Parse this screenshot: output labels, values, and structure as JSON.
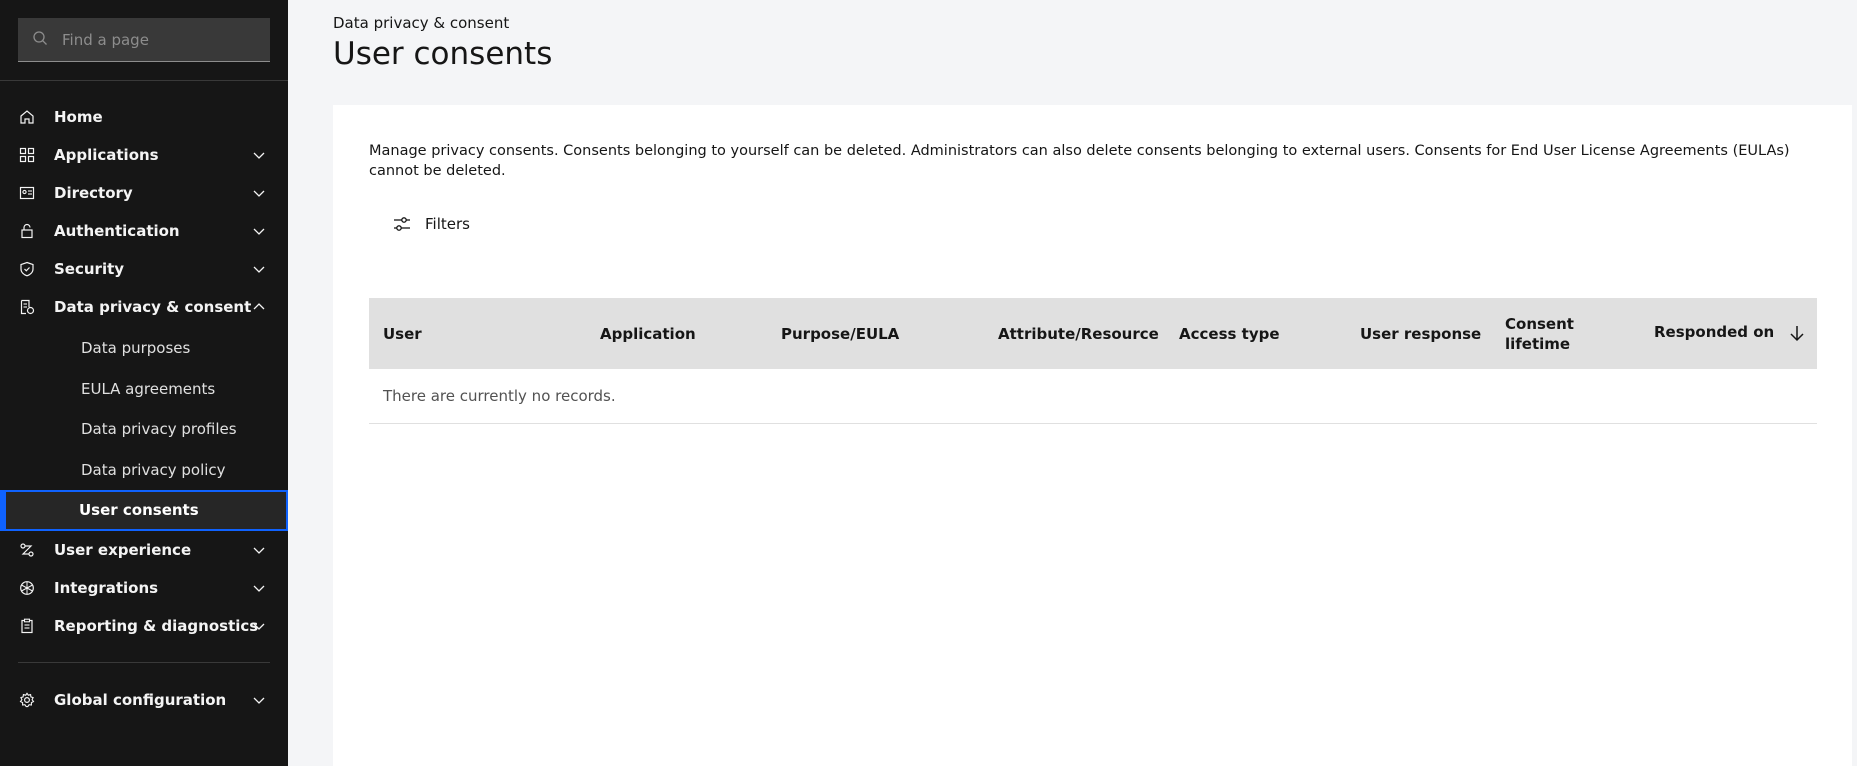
{
  "search": {
    "placeholder": "Find a page"
  },
  "nav": {
    "home": "Home",
    "applications": "Applications",
    "directory": "Directory",
    "authentication": "Authentication",
    "security": "Security",
    "data_privacy": "Data privacy & consent",
    "sub": {
      "data_purposes": "Data purposes",
      "eula": "EULA agreements",
      "profiles": "Data privacy profiles",
      "policy": "Data privacy policy",
      "user_consents": "User consents"
    },
    "user_experience": "User experience",
    "integrations": "Integrations",
    "reporting": "Reporting & diagnostics",
    "global_config": "Global configuration"
  },
  "header": {
    "breadcrumb": "Data privacy & consent",
    "title": "User consents"
  },
  "main": {
    "description": "Manage privacy consents. Consents belonging to yourself can be deleted. Administrators can also delete consents belonging to external users. Consents for End User License Agreements (EULAs) cannot be deleted.",
    "filters_label": "Filters"
  },
  "table": {
    "columns": [
      "User",
      "Application",
      "Purpose/EULA",
      "Attribute/Resource",
      "Access type",
      "User response",
      "Consent lifetime",
      "Responded on"
    ],
    "empty_message": "There are currently no records."
  },
  "colors": {
    "sidebar_bg": "#161616",
    "active_border": "#0f62fe",
    "header_row": "#e0e0e0"
  }
}
